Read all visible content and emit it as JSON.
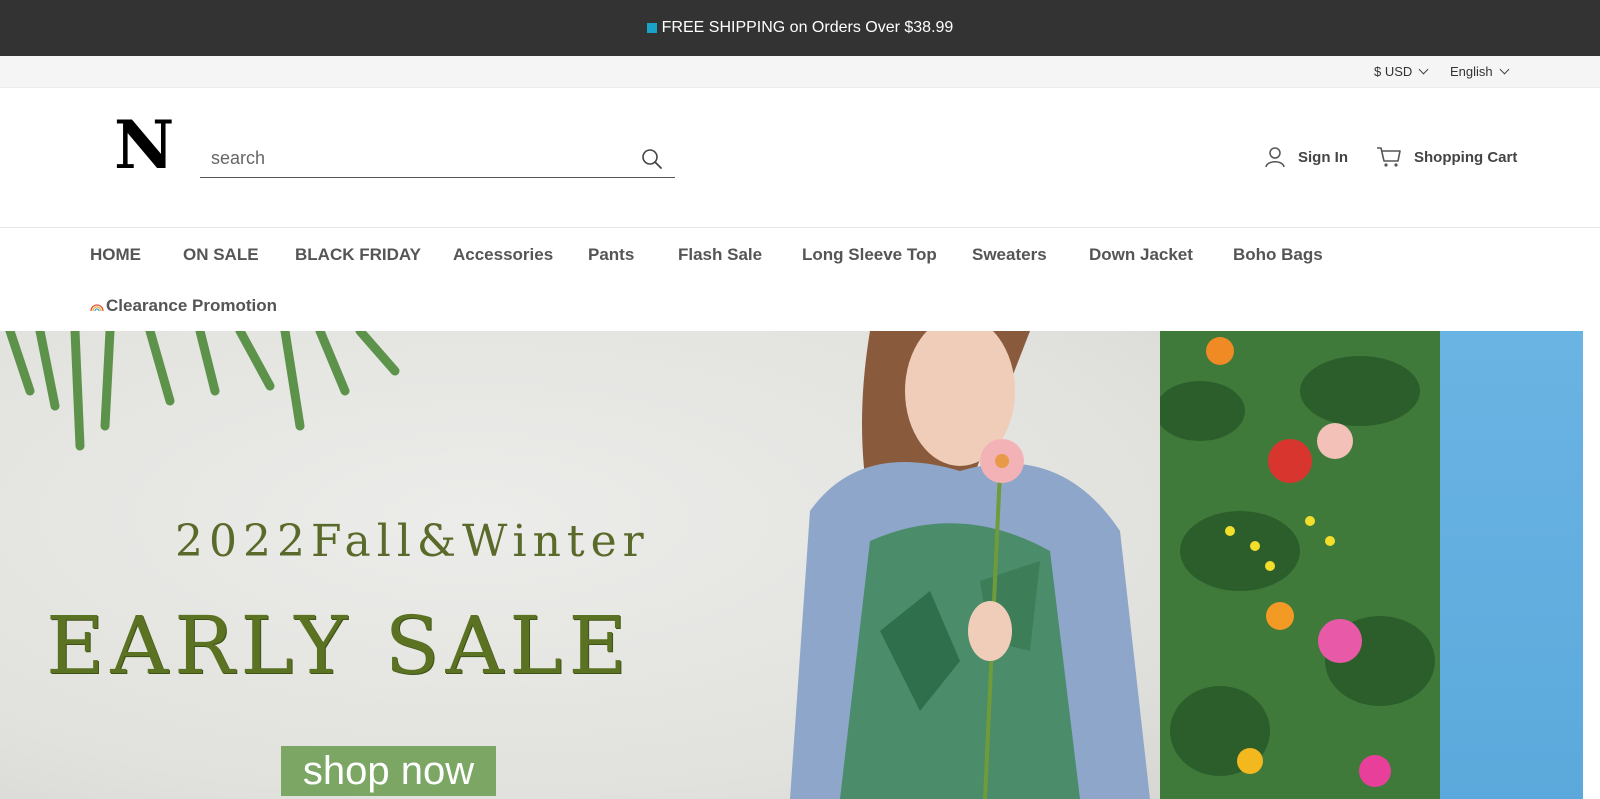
{
  "announcement": {
    "text": "FREE SHIPPING on Orders Over $38.99"
  },
  "utility": {
    "currency": "$ USD",
    "language": "English"
  },
  "header": {
    "logo": "N",
    "search_placeholder": "search",
    "sign_in": "Sign In",
    "cart": "Shopping Cart"
  },
  "nav": {
    "items": [
      {
        "label": "HOME"
      },
      {
        "label": "ON SALE"
      },
      {
        "label": "BLACK FRIDAY"
      },
      {
        "label": "Accessories"
      },
      {
        "label": "Pants"
      },
      {
        "label": "Flash Sale"
      },
      {
        "label": "Long Sleeve Top"
      },
      {
        "label": "Sweaters"
      },
      {
        "label": "Down Jacket"
      },
      {
        "label": "Boho Bags"
      },
      {
        "label": "Clearance Promotion"
      }
    ]
  },
  "hero": {
    "subtitle": "2022Fall&Winter",
    "title": "EARLY SALE",
    "button": "shop now"
  },
  "colors": {
    "announcement_bg": "#333333",
    "accent_square": "#1aa3c9",
    "hero_title": "#5b7223",
    "shop_button": "#7ba664"
  },
  "icons": [
    "search-icon",
    "user-icon",
    "cart-icon",
    "chevron-down-icon",
    "rainbow-icon"
  ]
}
